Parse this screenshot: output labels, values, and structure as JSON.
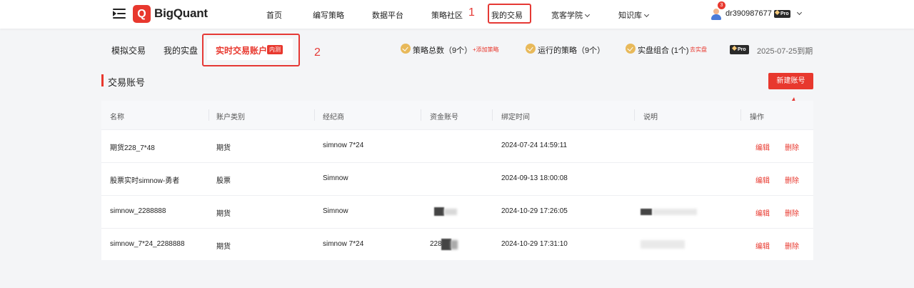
{
  "header": {
    "logo_text": "BigQuant",
    "nav": [
      {
        "label": "首页"
      },
      {
        "label": "编写策略"
      },
      {
        "label": "数据平台"
      },
      {
        "label": "策略社区"
      },
      {
        "label": "我的交易"
      },
      {
        "label": "宽客学院"
      },
      {
        "label": "知识库"
      }
    ],
    "notification_count": "3",
    "username": "dr390987677",
    "pro_label": "Pro"
  },
  "annotations": {
    "one": "1",
    "two": "2"
  },
  "subnav": {
    "tabs": [
      {
        "label": "模拟交易"
      },
      {
        "label": "我的实盘"
      },
      {
        "label": "实时交易账户"
      }
    ],
    "inner_badge": "内测",
    "stats": [
      {
        "label": "策略总数（9个）",
        "link": "+添加策略"
      },
      {
        "label": "运行的策略（9个）"
      },
      {
        "label": "实盘组合 (1个)",
        "link": "去实盘"
      }
    ],
    "pro_label": "Pro",
    "expire": "2025-07-25到期"
  },
  "section": {
    "title": "交易账号",
    "new_button": "新建账号"
  },
  "table": {
    "headers": [
      "名称",
      "账户类别",
      "经纪商",
      "资金账号",
      "绑定时间",
      "说明",
      "操作"
    ],
    "rows": [
      {
        "name": "期货228_7*48",
        "type": "期货",
        "broker": "simnow 7*24",
        "account": "",
        "time": "2024-07-24 14:59:11",
        "edit": "编辑",
        "delete": "删除"
      },
      {
        "name": "股票实时simnow-勇者",
        "type": "股票",
        "broker": "Simnow",
        "account": "",
        "time": "2024-09-13 18:00:08",
        "edit": "编辑",
        "delete": "删除"
      },
      {
        "name": "simnow_2288888",
        "type": "期货",
        "broker": "Simnow",
        "account": "",
        "time": "2024-10-29 17:26:05",
        "edit": "编辑",
        "delete": "删除"
      },
      {
        "name": "simnow_7*24_2288888",
        "type": "期货",
        "broker": "simnow 7*24",
        "account": "228",
        "time": "2024-10-29 17:31:10",
        "edit": "编辑",
        "delete": "删除"
      }
    ]
  }
}
